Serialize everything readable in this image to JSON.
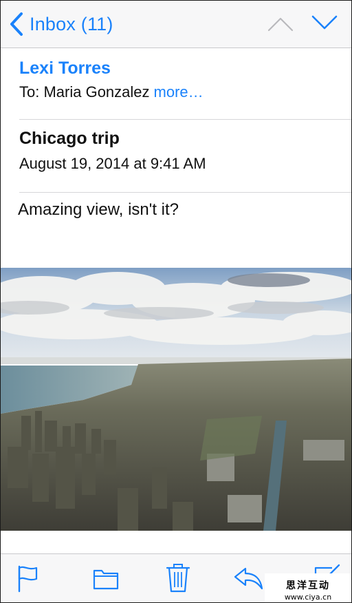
{
  "nav": {
    "back_label": "Inbox (11)",
    "accent_color": "#1a82fb",
    "icons": [
      "chevron-left-icon",
      "chevron-up-icon",
      "chevron-down-icon"
    ]
  },
  "message": {
    "sender": "Lexi Torres",
    "to_prefix": "To: Maria Gonzalez",
    "more_label": "more…",
    "subject": "Chicago trip",
    "date": "August 19, 2014 at 9:41 AM",
    "body": "Amazing view, isn't it?"
  },
  "toolbar": {
    "icons": [
      "flag-icon",
      "folder-icon",
      "trash-icon",
      "reply-icon",
      "compose-icon"
    ]
  },
  "watermark": {
    "top": "思洋互动",
    "bottom": "www.ciya.cn"
  }
}
